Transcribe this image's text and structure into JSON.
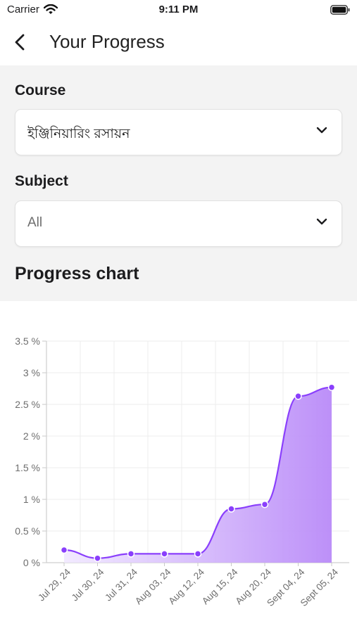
{
  "status_bar": {
    "carrier": "Carrier",
    "time": "9:11 PM"
  },
  "header": {
    "title": "Your Progress"
  },
  "filters": {
    "course": {
      "label": "Course",
      "value": "ইঞ্জিনিয়ারিং রসায়ন"
    },
    "subject": {
      "label": "Subject",
      "value": "All"
    }
  },
  "section": {
    "title": "Progress chart"
  },
  "colors": {
    "accent": "#8a3ffc",
    "fill_light": "#f1e8ff",
    "fill_dark": "#b98af8"
  },
  "chart_data": {
    "type": "area",
    "categories": [
      "Jul 29, 24",
      "Jul 30, 24",
      "Jul 31, 24",
      "Aug 03, 24",
      "Aug 12, 24",
      "Aug 15, 24",
      "Aug 20, 24",
      "Sept 04, 24",
      "Sept 05, 24"
    ],
    "values": [
      0.2,
      0.07,
      0.14,
      0.14,
      0.14,
      0.85,
      0.92,
      2.63,
      2.77
    ],
    "y_ticks": [
      "0 %",
      "0.5 %",
      "1 %",
      "1.5 %",
      "2 %",
      "2.5 %",
      "3 %",
      "3.5 %"
    ],
    "ylim": [
      0,
      3.5
    ],
    "grid": true
  }
}
